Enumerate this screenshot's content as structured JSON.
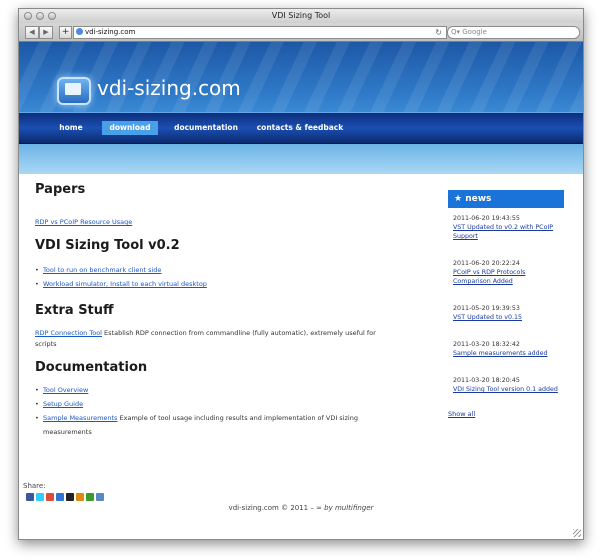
{
  "window": {
    "title": "VDI Sizing Tool"
  },
  "browser": {
    "back_label": "◀",
    "forward_label": "▶",
    "add_label": "+",
    "url": "vdi-sizing.com",
    "reload_label": "↻",
    "search_placeholder": "Q▾ Google"
  },
  "site": {
    "logo_text": "vdi-sizing.com",
    "nav": [
      {
        "label": "home",
        "active": false
      },
      {
        "label": "download",
        "active": true
      },
      {
        "label": "documentation",
        "active": false
      },
      {
        "label": "contacts & feedback",
        "active": false
      }
    ]
  },
  "main": {
    "papers": {
      "heading": "Papers",
      "link": "RDP vs PCoIP Resource Usage"
    },
    "tool": {
      "heading": "VDI Sizing Tool v0.2",
      "items": [
        "Tool to run on benchmark client side",
        "Workload simulator, Install to each virtual desktop"
      ]
    },
    "extra": {
      "heading": "Extra Stuff",
      "link": "RDP Connection Tool",
      "text": " Establish RDP connection from commandline (fully automatic), extremely useful for scripts"
    },
    "docs": {
      "heading": "Documentation",
      "links": [
        "Tool Overview",
        "Setup Guide"
      ],
      "sample_link": "Sample Measurements",
      "sample_text": " Example of tool usage including results and implementation of VDI sizing measurements"
    }
  },
  "news": {
    "heading": "★ news",
    "items": [
      {
        "date": "2011-06-20 19:43:55",
        "title": "VST Updated to v0.2 with PCoIP Support"
      },
      {
        "date": "2011-06-20 20:22:24",
        "title": "PCoIP vs RDP Protocols Comparison Added"
      },
      {
        "date": "2011-05-20 19:39:53",
        "title": "VST Updated to v0.15"
      },
      {
        "date": "2011-03-20 18:32:42",
        "title": "Sample measurements added"
      },
      {
        "date": "2011-03-20 18:20:45",
        "title": "VDI Sizing Tool version 0.1 added"
      }
    ],
    "show_all": "Show all"
  },
  "share": {
    "label": "Share:",
    "icons": [
      "facebook-icon",
      "twitter-icon",
      "google-icon",
      "delicious-icon",
      "myspace-icon",
      "digg-icon",
      "stumble-icon",
      "email-icon"
    ]
  },
  "footer": {
    "text": "vdi-sizing.com © 2011 – ∞",
    "by": " by multifinger"
  }
}
